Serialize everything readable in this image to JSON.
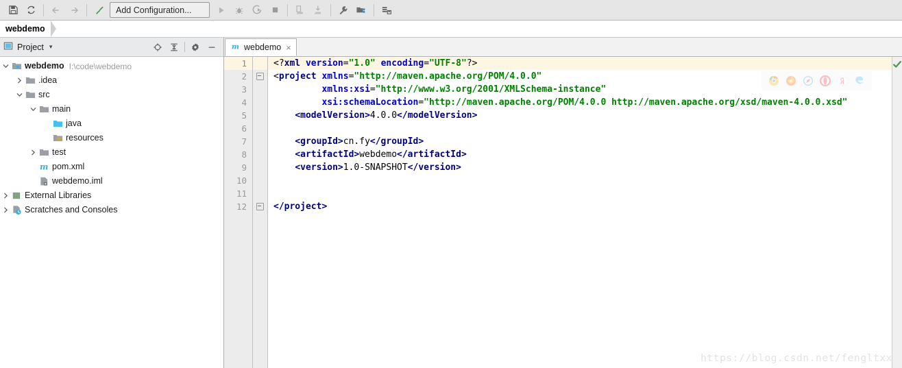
{
  "toolbar": {
    "buttons": [
      {
        "name": "save-all-icon",
        "title": "Save All"
      },
      {
        "name": "sync-refresh-icon",
        "title": "Synchronize"
      },
      {
        "name": "back-arrow-icon",
        "title": "Back"
      },
      {
        "name": "forward-arrow-icon",
        "title": "Forward"
      },
      {
        "name": "build-hammer-icon",
        "title": "Build Project"
      }
    ],
    "run_configuration": "Add Configuration...",
    "right_buttons": [
      {
        "name": "run-icon",
        "title": "Run"
      },
      {
        "name": "debug-icon",
        "title": "Debug"
      },
      {
        "name": "run-coverage-icon",
        "title": "Run with Coverage"
      },
      {
        "name": "stop-icon",
        "title": "Stop"
      },
      {
        "name": "update-app-icon",
        "title": "Update Application"
      },
      {
        "name": "deploy-icon",
        "title": "Deploy"
      },
      {
        "name": "settings-wrench-icon",
        "title": "Project Structure"
      },
      {
        "name": "project-structure-icon",
        "title": "Settings"
      },
      {
        "name": "database-icon",
        "title": "Database"
      }
    ]
  },
  "breadcrumb": {
    "project_name": "webdemo"
  },
  "project_panel": {
    "title": "Project",
    "dropdown_caret": "▾",
    "toolbar_buttons": [
      {
        "name": "locate-target-icon",
        "title": "Select Opened File"
      },
      {
        "name": "collapse-all-icon",
        "title": "Collapse All"
      },
      {
        "name": "gear-icon",
        "title": "Settings"
      },
      {
        "name": "hide-icon",
        "title": "Hide"
      }
    ],
    "tree": [
      {
        "label": "webdemo",
        "path": "I:\\code\\webdemo",
        "depth": 0,
        "twist": "down",
        "icon": "module-folder-icon",
        "bold": true
      },
      {
        "label": ".idea",
        "path": "",
        "depth": 1,
        "twist": "right",
        "icon": "folder-icon",
        "bold": false
      },
      {
        "label": "src",
        "path": "",
        "depth": 1,
        "twist": "down",
        "icon": "folder-icon",
        "bold": false
      },
      {
        "label": "main",
        "path": "",
        "depth": 2,
        "twist": "down",
        "icon": "folder-icon",
        "bold": false
      },
      {
        "label": "java",
        "path": "",
        "depth": 3,
        "twist": "none",
        "icon": "source-root-folder-icon",
        "bold": false
      },
      {
        "label": "resources",
        "path": "",
        "depth": 3,
        "twist": "none",
        "icon": "resources-root-folder-icon",
        "bold": false
      },
      {
        "label": "test",
        "path": "",
        "depth": 2,
        "twist": "right",
        "icon": "folder-icon",
        "bold": false
      },
      {
        "label": "pom.xml",
        "path": "",
        "depth": 2,
        "twist": "none",
        "icon": "maven-file-icon",
        "bold": false
      },
      {
        "label": "webdemo.iml",
        "path": "",
        "depth": 2,
        "twist": "none",
        "icon": "iml-file-icon",
        "bold": false
      },
      {
        "label": "External Libraries",
        "path": "",
        "depth": 0,
        "twist": "right",
        "icon": "external-libraries-icon",
        "bold": false
      },
      {
        "label": "Scratches and Consoles",
        "path": "",
        "depth": 0,
        "twist": "right",
        "icon": "scratches-icon",
        "bold": false
      }
    ]
  },
  "editor": {
    "tabs": [
      {
        "label": "webdemo",
        "icon": "maven-file-icon",
        "close": "×",
        "active": true
      }
    ],
    "current_line": 1,
    "line_numbers": [
      "1",
      "2",
      "3",
      "4",
      "5",
      "6",
      "7",
      "8",
      "9",
      "10",
      "11",
      "12"
    ],
    "fold_lines": [
      2,
      12
    ],
    "inspection_status": "ok-check-icon",
    "browser_popup": [
      {
        "name": "chrome-icon"
      },
      {
        "name": "firefox-icon"
      },
      {
        "name": "safari-icon"
      },
      {
        "name": "opera-icon"
      },
      {
        "name": "yandex-icon"
      },
      {
        "name": "edge-icon"
      }
    ],
    "code_lines": [
      [
        {
          "t": "<?",
          "c": "plain"
        },
        {
          "t": "xml",
          "c": "tag"
        },
        {
          "t": " ",
          "c": "plain"
        },
        {
          "t": "version",
          "c": "attr"
        },
        {
          "t": "=",
          "c": "plain"
        },
        {
          "t": "\"1.0\"",
          "c": "val"
        },
        {
          "t": " ",
          "c": "plain"
        },
        {
          "t": "encoding",
          "c": "attr"
        },
        {
          "t": "=",
          "c": "plain"
        },
        {
          "t": "\"UTF-8\"",
          "c": "val"
        },
        {
          "t": "?>",
          "c": "plain"
        }
      ],
      [
        {
          "t": "<",
          "c": "plain"
        },
        {
          "t": "project",
          "c": "tag"
        },
        {
          "t": " ",
          "c": "plain"
        },
        {
          "t": "xmlns",
          "c": "attr"
        },
        {
          "t": "=",
          "c": "plain"
        },
        {
          "t": "\"http://maven.apache.org/POM/4.0.0\"",
          "c": "val"
        }
      ],
      [
        {
          "t": "         ",
          "c": "plain"
        },
        {
          "t": "xmlns:xsi",
          "c": "attr"
        },
        {
          "t": "=",
          "c": "plain"
        },
        {
          "t": "\"http://www.w3.org/2001/XMLSchema-instance\"",
          "c": "val"
        }
      ],
      [
        {
          "t": "         ",
          "c": "plain"
        },
        {
          "t": "xsi:schemaLocation",
          "c": "attr"
        },
        {
          "t": "=",
          "c": "plain"
        },
        {
          "t": "\"http://maven.apache.org/POM/4.0.0 http://maven.apache.org/xsd/maven-4.0.0.xsd\"",
          "c": "val"
        }
      ],
      [
        {
          "t": "    ",
          "c": "plain"
        },
        {
          "t": "<",
          "c": "tag"
        },
        {
          "t": "modelVersion",
          "c": "tag"
        },
        {
          "t": ">",
          "c": "tag"
        },
        {
          "t": "4.0.0",
          "c": "plain"
        },
        {
          "t": "</",
          "c": "tag"
        },
        {
          "t": "modelVersion",
          "c": "tag"
        },
        {
          "t": ">",
          "c": "tag"
        }
      ],
      [],
      [
        {
          "t": "    ",
          "c": "plain"
        },
        {
          "t": "<groupId>",
          "c": "tag"
        },
        {
          "t": "cn.fy",
          "c": "plain"
        },
        {
          "t": "</groupId>",
          "c": "tag"
        }
      ],
      [
        {
          "t": "    ",
          "c": "plain"
        },
        {
          "t": "<artifactId>",
          "c": "tag"
        },
        {
          "t": "webdemo",
          "c": "plain"
        },
        {
          "t": "</artifactId>",
          "c": "tag"
        }
      ],
      [
        {
          "t": "    ",
          "c": "plain"
        },
        {
          "t": "<version>",
          "c": "tag"
        },
        {
          "t": "1.0-SNAPSHOT",
          "c": "plain"
        },
        {
          "t": "</version>",
          "c": "tag"
        }
      ],
      [],
      [],
      [
        {
          "t": "</project>",
          "c": "tag"
        }
      ]
    ]
  },
  "watermark": "https://blog.csdn.net/fengltxx"
}
